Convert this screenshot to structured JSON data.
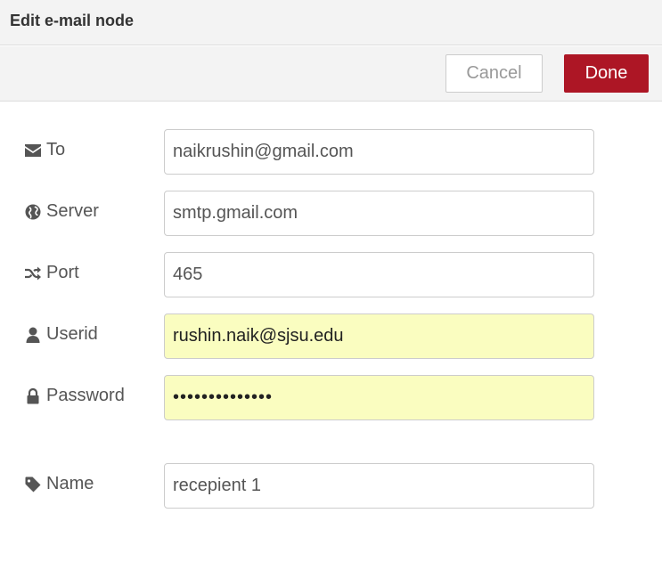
{
  "dialog": {
    "title": "Edit e-mail node"
  },
  "toolbar": {
    "cancel_label": "Cancel",
    "done_label": "Done",
    "done_color": "#ad1625"
  },
  "fields": {
    "to": {
      "label": "To",
      "icon": "envelope-icon",
      "value": "naikrushin@gmail.com"
    },
    "server": {
      "label": "Server",
      "icon": "globe-icon",
      "value": "smtp.gmail.com"
    },
    "port": {
      "label": "Port",
      "icon": "random-icon",
      "value": "465"
    },
    "userid": {
      "label": "Userid",
      "icon": "user-icon",
      "value": "rushin.naik@sjsu.edu",
      "autofill_color": "#fafdc0"
    },
    "password": {
      "label": "Password",
      "icon": "lock-icon",
      "value": "••••••••••••••",
      "autofill_color": "#fafdc0"
    },
    "name": {
      "label": "Name",
      "icon": "tag-icon",
      "value": "recepient 1"
    }
  }
}
